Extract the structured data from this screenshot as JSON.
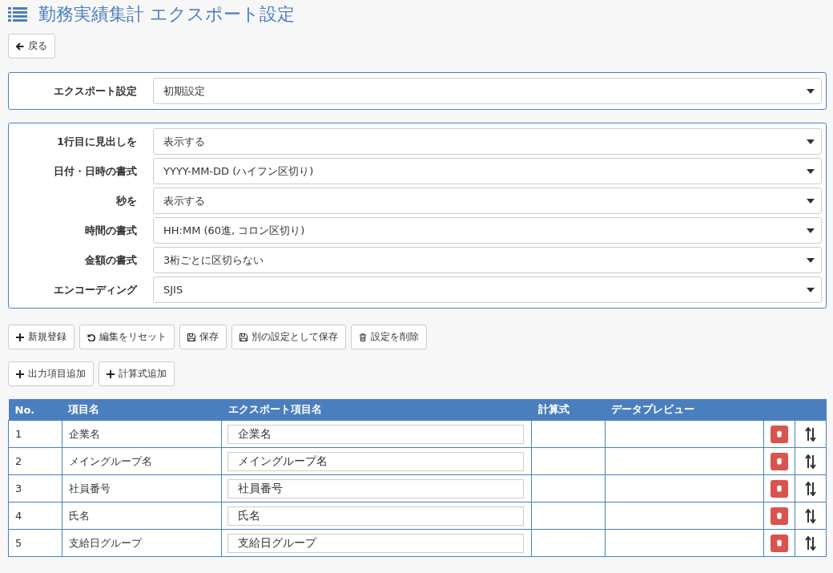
{
  "page": {
    "title": "勤務実績集計 エクスポート設定",
    "back_button": "戻る"
  },
  "export_setting": {
    "label": "エクスポート設定",
    "value": "初期設定"
  },
  "options": [
    {
      "label": "1行目に見出しを",
      "value": "表示する"
    },
    {
      "label": "日付・日時の書式",
      "value": "YYYY-MM-DD (ハイフン区切り)"
    },
    {
      "label": "秒を",
      "value": "表示する"
    },
    {
      "label": "時間の書式",
      "value": "HH:MM (60進, コロン区切り)"
    },
    {
      "label": "金額の書式",
      "value": "3桁ごとに区切らない"
    },
    {
      "label": "エンコーディング",
      "value": "SJIS"
    }
  ],
  "action_buttons": [
    {
      "kind": "add",
      "label": "新規登録"
    },
    {
      "kind": "reset",
      "label": "編集をリセット"
    },
    {
      "kind": "save",
      "label": "保存"
    },
    {
      "kind": "save",
      "label": "別の設定として保存"
    },
    {
      "kind": "delete",
      "label": "設定を削除"
    }
  ],
  "add_buttons": [
    {
      "kind": "add",
      "label": "出力項目追加"
    },
    {
      "kind": "add",
      "label": "計算式追加"
    }
  ],
  "table": {
    "columns": [
      "No.",
      "項目名",
      "エクスポート項目名",
      "計算式",
      "データプレビュー"
    ],
    "rows": [
      {
        "no": "1",
        "name": "企業名",
        "export_name": "企業名"
      },
      {
        "no": "2",
        "name": "メイングループ名",
        "export_name": "メイングループ名"
      },
      {
        "no": "3",
        "name": "社員番号",
        "export_name": "社員番号"
      },
      {
        "no": "4",
        "name": "氏名",
        "export_name": "氏名"
      },
      {
        "no": "5",
        "name": "支給日グループ",
        "export_name": "支給日グループ"
      }
    ]
  }
}
